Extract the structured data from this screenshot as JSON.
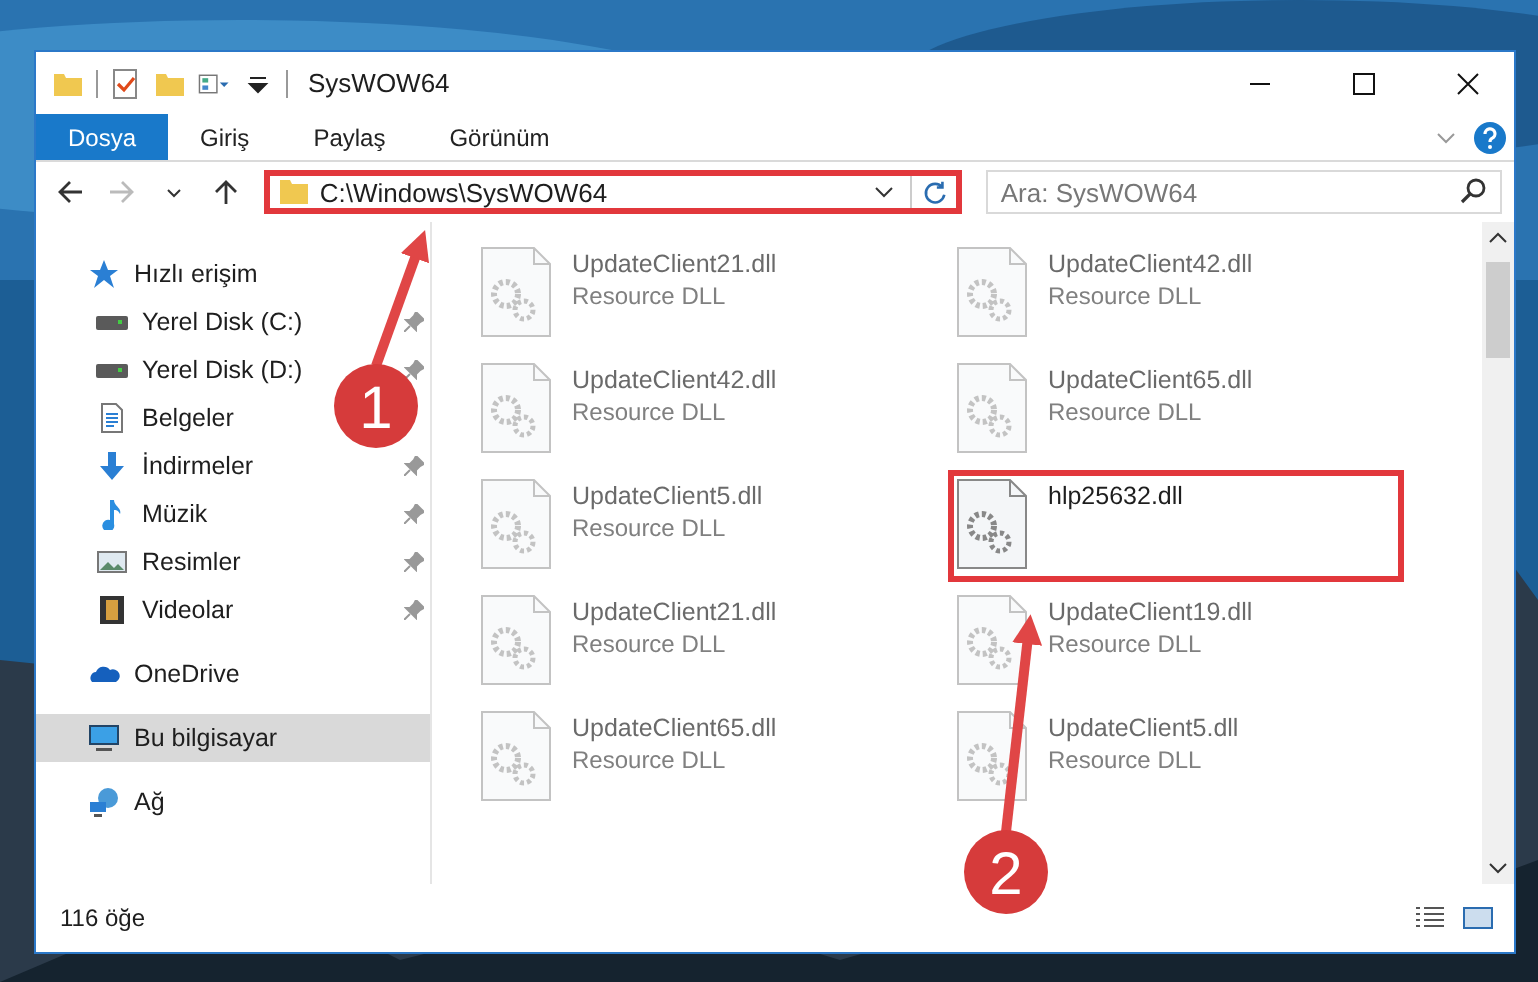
{
  "window": {
    "title": "SysWOW64"
  },
  "ribbon_tabs": [
    {
      "label": "Dosya",
      "selected": true
    },
    {
      "label": "Giriş",
      "selected": false
    },
    {
      "label": "Paylaş",
      "selected": false
    },
    {
      "label": "Görünüm",
      "selected": false
    }
  ],
  "address": {
    "path": "C:\\Windows\\SysWOW64",
    "highlighted": true
  },
  "search": {
    "placeholder": "Ara: SysWOW64"
  },
  "sidebar": {
    "items": [
      {
        "label": "Hızlı erişim",
        "kind": "star",
        "selected": false,
        "children": [
          {
            "label": "Yerel Disk (C:)",
            "kind": "drive",
            "pinned": true,
            "selected": false
          },
          {
            "label": "Yerel Disk (D:)",
            "kind": "drive",
            "pinned": true,
            "selected": false
          },
          {
            "label": "Belgeler",
            "kind": "documents",
            "pinned": false,
            "selected": false
          },
          {
            "label": "İndirmeler",
            "kind": "download",
            "pinned": true,
            "selected": false
          },
          {
            "label": "Müzik",
            "kind": "music",
            "pinned": true,
            "selected": false
          },
          {
            "label": "Resimler",
            "kind": "pictures",
            "pinned": true,
            "selected": false
          },
          {
            "label": "Videolar",
            "kind": "videos",
            "pinned": true,
            "selected": false
          }
        ]
      },
      {
        "label": "OneDrive",
        "kind": "cloud",
        "selected": false
      },
      {
        "label": "Bu bilgisayar",
        "kind": "computer",
        "selected": true
      },
      {
        "label": "Ağ",
        "kind": "network",
        "selected": false
      }
    ]
  },
  "files": [
    {
      "name": "UpdateClient21.dll",
      "type": "Resource DLL",
      "blurred": true,
      "highlighted": false
    },
    {
      "name": "UpdateClient42.dll",
      "type": "Resource DLL",
      "blurred": true,
      "highlighted": false
    },
    {
      "name": "UpdateClient42.dll",
      "type": "Resource DLL",
      "blurred": true,
      "highlighted": false
    },
    {
      "name": "UpdateClient65.dll",
      "type": "Resource DLL",
      "blurred": true,
      "highlighted": false
    },
    {
      "name": "UpdateClient5.dll",
      "type": "Resource DLL",
      "blurred": true,
      "highlighted": false
    },
    {
      "name": "hlp25632.dll",
      "blurred": false,
      "highlighted": true
    },
    {
      "name": "UpdateClient21.dll",
      "type": "Resource DLL",
      "blurred": true,
      "highlighted": false
    },
    {
      "name": "UpdateClient19.dll",
      "type": "Resource DLL",
      "blurred": true,
      "highlighted": false
    },
    {
      "name": "UpdateClient65.dll",
      "type": "Resource DLL",
      "blurred": true,
      "highlighted": false
    },
    {
      "name": "UpdateClient5.dll",
      "type": "Resource DLL",
      "blurred": true,
      "highlighted": false
    }
  ],
  "status_bar": {
    "item_count": "116 öğe"
  },
  "annotations": [
    {
      "label": "1"
    },
    {
      "label": "2"
    }
  ]
}
